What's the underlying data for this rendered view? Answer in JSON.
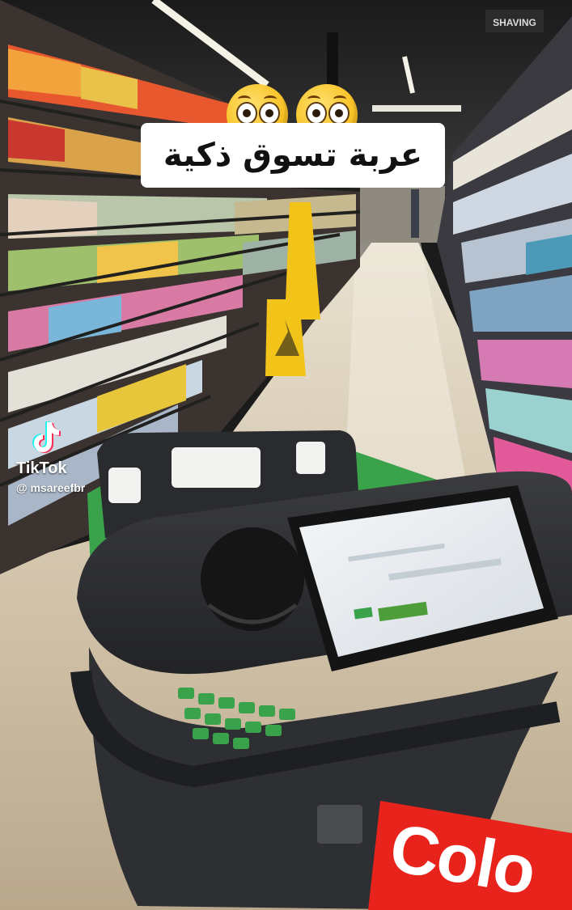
{
  "caption": {
    "text": "عربة تسوق ذكية"
  },
  "emojis": [
    "flushed-face-emoji",
    "flushed-face-emoji"
  ],
  "watermark": {
    "brand": "TikTok",
    "handle": "@ msareefbr"
  },
  "aisle_sign": {
    "text": "SHAVING"
  },
  "product_label": {
    "text": "Colo"
  },
  "colors": {
    "floor": "#c9b9a0",
    "cart_frame": "#2c2d30",
    "cart_accent": "#3aa24a",
    "wet_floor_sign": "#f2c318",
    "box_red": "#e8231c"
  }
}
